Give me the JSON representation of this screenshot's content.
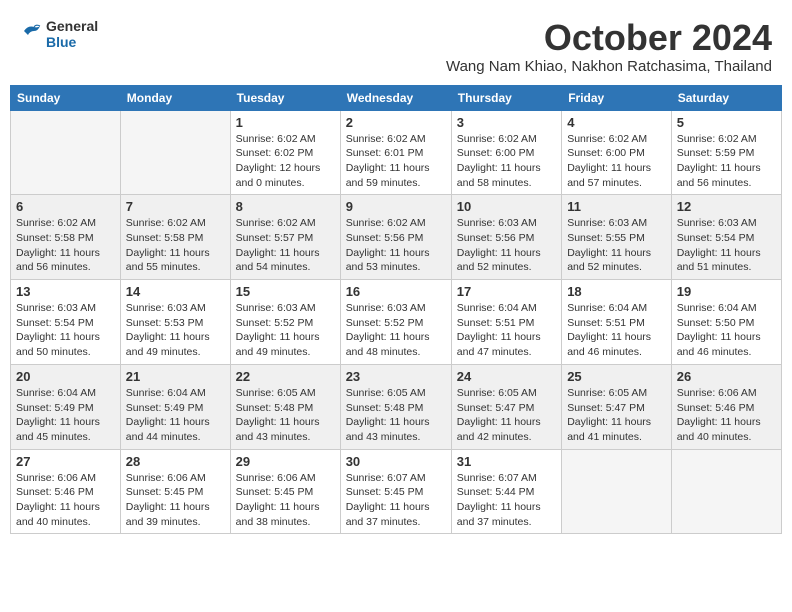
{
  "header": {
    "logo_general": "General",
    "logo_blue": "Blue",
    "month": "October 2024",
    "location": "Wang Nam Khiao, Nakhon Ratchasima, Thailand"
  },
  "weekdays": [
    "Sunday",
    "Monday",
    "Tuesday",
    "Wednesday",
    "Thursday",
    "Friday",
    "Saturday"
  ],
  "weeks": [
    [
      {
        "day": "",
        "empty": true
      },
      {
        "day": "",
        "empty": true
      },
      {
        "day": "1",
        "sunrise": "6:02 AM",
        "sunset": "6:02 PM",
        "daylight": "12 hours and 0 minutes."
      },
      {
        "day": "2",
        "sunrise": "6:02 AM",
        "sunset": "6:01 PM",
        "daylight": "11 hours and 59 minutes."
      },
      {
        "day": "3",
        "sunrise": "6:02 AM",
        "sunset": "6:00 PM",
        "daylight": "11 hours and 58 minutes."
      },
      {
        "day": "4",
        "sunrise": "6:02 AM",
        "sunset": "6:00 PM",
        "daylight": "11 hours and 57 minutes."
      },
      {
        "day": "5",
        "sunrise": "6:02 AM",
        "sunset": "5:59 PM",
        "daylight": "11 hours and 56 minutes."
      }
    ],
    [
      {
        "day": "6",
        "sunrise": "6:02 AM",
        "sunset": "5:58 PM",
        "daylight": "11 hours and 56 minutes."
      },
      {
        "day": "7",
        "sunrise": "6:02 AM",
        "sunset": "5:58 PM",
        "daylight": "11 hours and 55 minutes."
      },
      {
        "day": "8",
        "sunrise": "6:02 AM",
        "sunset": "5:57 PM",
        "daylight": "11 hours and 54 minutes."
      },
      {
        "day": "9",
        "sunrise": "6:02 AM",
        "sunset": "5:56 PM",
        "daylight": "11 hours and 53 minutes."
      },
      {
        "day": "10",
        "sunrise": "6:03 AM",
        "sunset": "5:56 PM",
        "daylight": "11 hours and 52 minutes."
      },
      {
        "day": "11",
        "sunrise": "6:03 AM",
        "sunset": "5:55 PM",
        "daylight": "11 hours and 52 minutes."
      },
      {
        "day": "12",
        "sunrise": "6:03 AM",
        "sunset": "5:54 PM",
        "daylight": "11 hours and 51 minutes."
      }
    ],
    [
      {
        "day": "13",
        "sunrise": "6:03 AM",
        "sunset": "5:54 PM",
        "daylight": "11 hours and 50 minutes."
      },
      {
        "day": "14",
        "sunrise": "6:03 AM",
        "sunset": "5:53 PM",
        "daylight": "11 hours and 49 minutes."
      },
      {
        "day": "15",
        "sunrise": "6:03 AM",
        "sunset": "5:52 PM",
        "daylight": "11 hours and 49 minutes."
      },
      {
        "day": "16",
        "sunrise": "6:03 AM",
        "sunset": "5:52 PM",
        "daylight": "11 hours and 48 minutes."
      },
      {
        "day": "17",
        "sunrise": "6:04 AM",
        "sunset": "5:51 PM",
        "daylight": "11 hours and 47 minutes."
      },
      {
        "day": "18",
        "sunrise": "6:04 AM",
        "sunset": "5:51 PM",
        "daylight": "11 hours and 46 minutes."
      },
      {
        "day": "19",
        "sunrise": "6:04 AM",
        "sunset": "5:50 PM",
        "daylight": "11 hours and 46 minutes."
      }
    ],
    [
      {
        "day": "20",
        "sunrise": "6:04 AM",
        "sunset": "5:49 PM",
        "daylight": "11 hours and 45 minutes."
      },
      {
        "day": "21",
        "sunrise": "6:04 AM",
        "sunset": "5:49 PM",
        "daylight": "11 hours and 44 minutes."
      },
      {
        "day": "22",
        "sunrise": "6:05 AM",
        "sunset": "5:48 PM",
        "daylight": "11 hours and 43 minutes."
      },
      {
        "day": "23",
        "sunrise": "6:05 AM",
        "sunset": "5:48 PM",
        "daylight": "11 hours and 43 minutes."
      },
      {
        "day": "24",
        "sunrise": "6:05 AM",
        "sunset": "5:47 PM",
        "daylight": "11 hours and 42 minutes."
      },
      {
        "day": "25",
        "sunrise": "6:05 AM",
        "sunset": "5:47 PM",
        "daylight": "11 hours and 41 minutes."
      },
      {
        "day": "26",
        "sunrise": "6:06 AM",
        "sunset": "5:46 PM",
        "daylight": "11 hours and 40 minutes."
      }
    ],
    [
      {
        "day": "27",
        "sunrise": "6:06 AM",
        "sunset": "5:46 PM",
        "daylight": "11 hours and 40 minutes."
      },
      {
        "day": "28",
        "sunrise": "6:06 AM",
        "sunset": "5:45 PM",
        "daylight": "11 hours and 39 minutes."
      },
      {
        "day": "29",
        "sunrise": "6:06 AM",
        "sunset": "5:45 PM",
        "daylight": "11 hours and 38 minutes."
      },
      {
        "day": "30",
        "sunrise": "6:07 AM",
        "sunset": "5:45 PM",
        "daylight": "11 hours and 37 minutes."
      },
      {
        "day": "31",
        "sunrise": "6:07 AM",
        "sunset": "5:44 PM",
        "daylight": "11 hours and 37 minutes."
      },
      {
        "day": "",
        "empty": true
      },
      {
        "day": "",
        "empty": true
      }
    ]
  ],
  "labels": {
    "sunrise_prefix": "Sunrise: ",
    "sunset_prefix": "Sunset: ",
    "daylight_prefix": "Daylight: "
  }
}
